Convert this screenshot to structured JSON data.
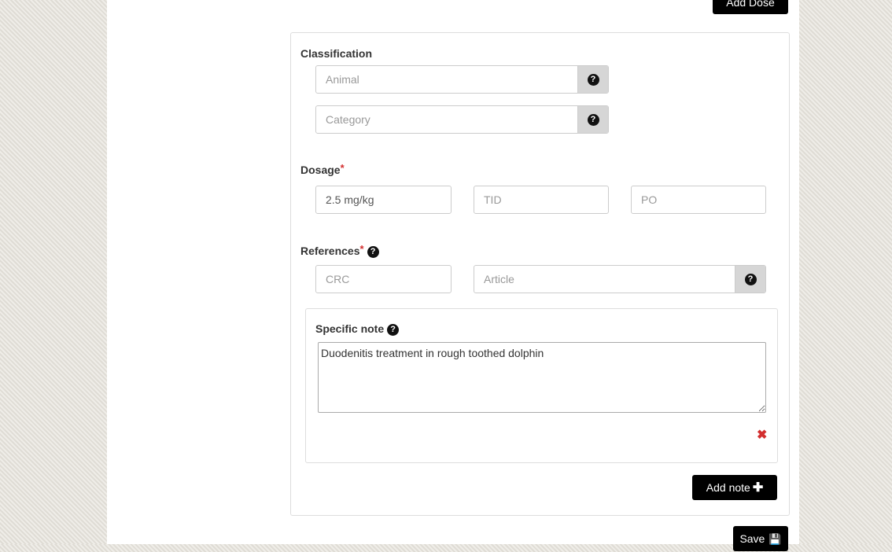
{
  "top_button": {
    "label": "Add Dose"
  },
  "classification": {
    "label": "Classification",
    "animal_placeholder": "Animal",
    "category_placeholder": "Category"
  },
  "dosage": {
    "label": "Dosage",
    "required_mark": "*",
    "amount_value": "2.5 mg/kg",
    "frequency_placeholder": "TID",
    "route_placeholder": "PO"
  },
  "references": {
    "label": "References",
    "required_mark": "*",
    "crc_placeholder": "CRC",
    "article_placeholder": "Article"
  },
  "specific_note": {
    "label": "Specific note",
    "text": "Duodenitis treatment in rough toothed dolphin",
    "remove_symbol": "✖"
  },
  "buttons": {
    "add_note": "Add note",
    "save": "Save"
  },
  "icons": {
    "help": "?",
    "plus": "✚",
    "save": "💾"
  },
  "colors": {
    "accent_button": "#000000",
    "required": "#d32f2f",
    "addon_bg": "#d6d6d6"
  }
}
